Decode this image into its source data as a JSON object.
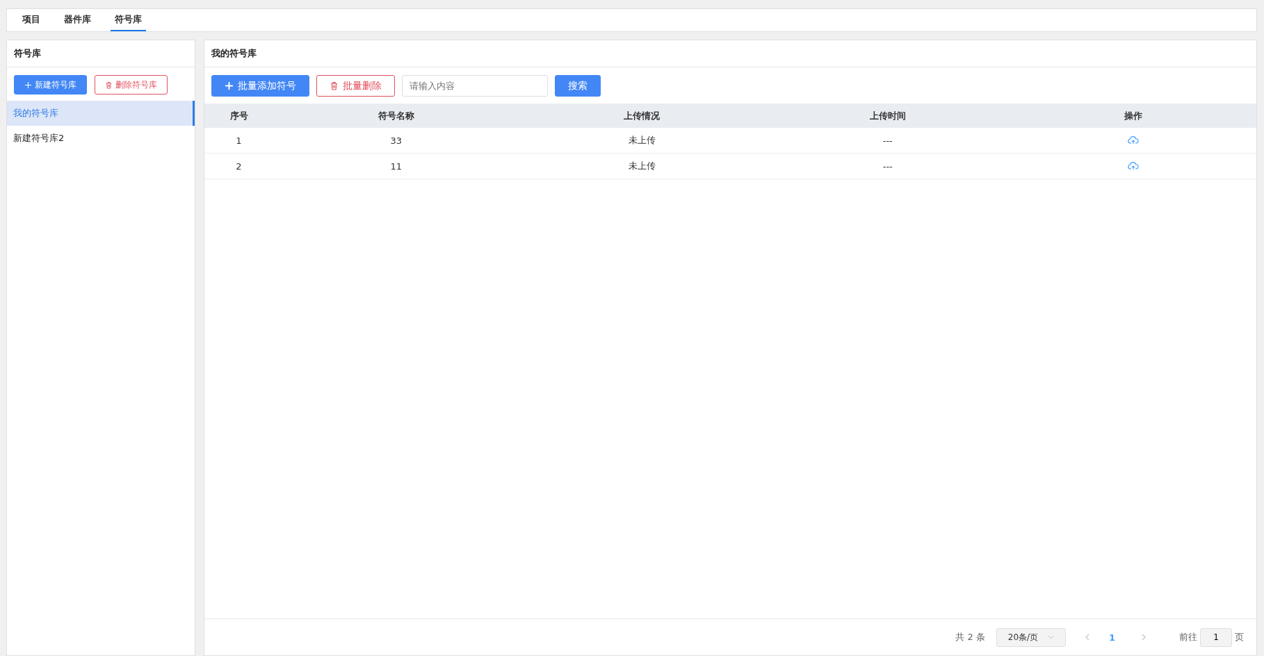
{
  "tabs": [
    {
      "label": "项目",
      "selected": false
    },
    {
      "label": "器件库",
      "selected": false
    },
    {
      "label": "符号库",
      "selected": true
    }
  ],
  "sidebar": {
    "title": "符号库",
    "buttons": [
      {
        "label": "新建符号库",
        "kind": "primary"
      },
      {
        "label": "删除符号库",
        "kind": "danger"
      }
    ],
    "items": [
      {
        "label": "我的符号库",
        "selected": true
      },
      {
        "label": "新建符号库2",
        "selected": false
      }
    ]
  },
  "main": {
    "title": "我的符号库",
    "toolbar": {
      "add_button": "批量添加符号",
      "delete_button": "批量删除",
      "search": {
        "placeholder": "请输入内容"
      },
      "search_button": "搜索"
    },
    "table": {
      "columns": [
        "序号",
        "符号名称",
        "上传情况",
        "上传时间",
        "操作"
      ],
      "rows": [
        {
          "cells": [
            "1",
            "33",
            "未上传",
            "---"
          ]
        },
        {
          "cells": [
            "2",
            "11",
            "未上传",
            "---"
          ]
        }
      ]
    },
    "pagination": {
      "total": "共 2 条",
      "page_size": "20条/页",
      "pages": [
        {
          "label": "1",
          "selected": true
        }
      ],
      "goto_label": "前往",
      "goto_value": "1",
      "page_suffix": "页"
    }
  }
}
